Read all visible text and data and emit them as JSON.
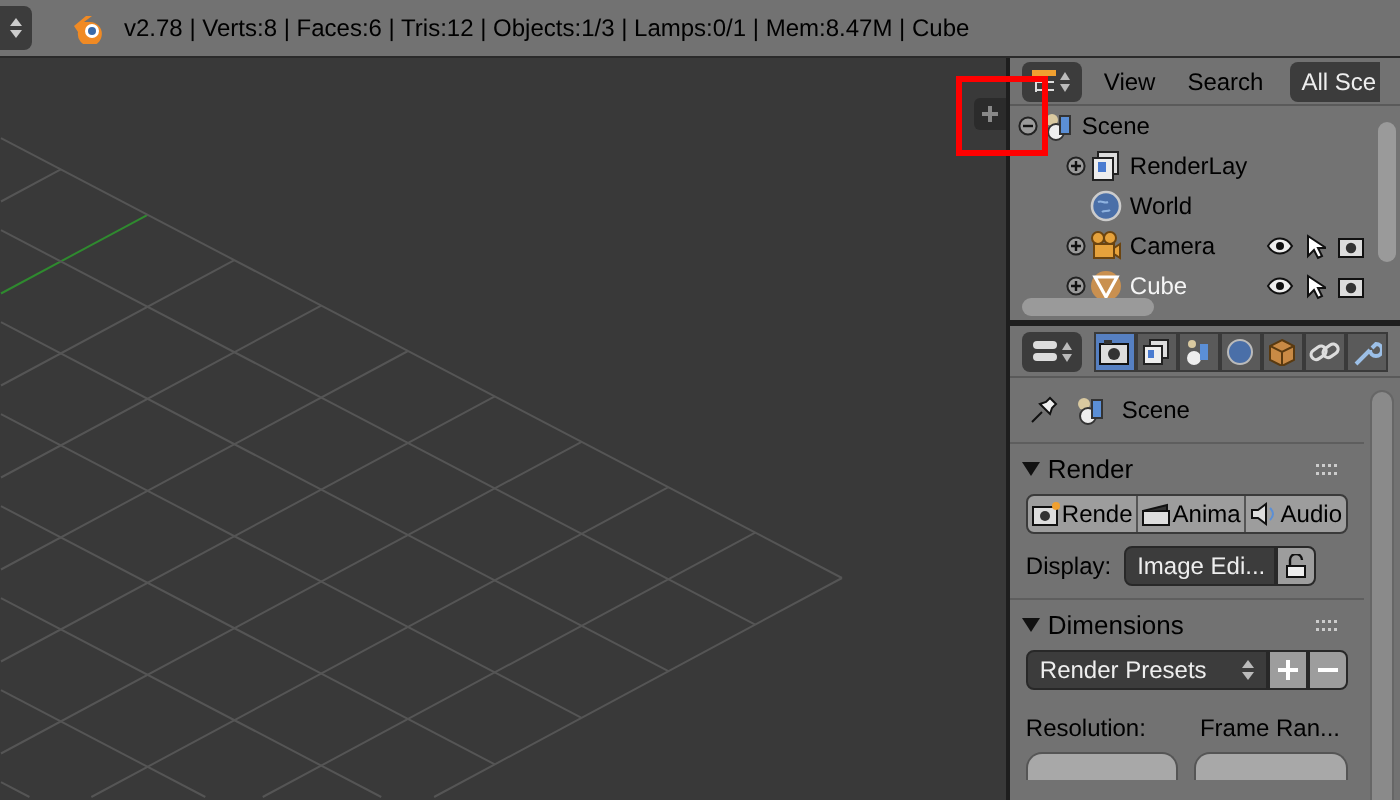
{
  "info_bar": {
    "stats": "v2.78 | Verts:8 | Faces:6 | Tris:12 | Objects:1/3 | Lamps:0/1 | Mem:8.47M | Cube"
  },
  "outliner": {
    "menus": [
      "View",
      "Search"
    ],
    "scene_selector": "All Sce",
    "items": [
      {
        "name": "Scene",
        "kind": "scene",
        "expanded": true,
        "children": [
          {
            "name": "RenderLay",
            "kind": "render_layers",
            "expanded": false,
            "selected": false
          },
          {
            "name": "World",
            "kind": "world",
            "selected": false
          },
          {
            "name": "Camera",
            "kind": "camera",
            "expanded": false,
            "selected": false
          },
          {
            "name": "Cube",
            "kind": "mesh",
            "expanded": false,
            "selected": true
          }
        ]
      }
    ]
  },
  "properties": {
    "tabs": [
      {
        "kind": "render",
        "selected": true
      },
      {
        "kind": "render_layers",
        "selected": false
      },
      {
        "kind": "scene",
        "selected": false
      },
      {
        "kind": "world",
        "selected": false
      },
      {
        "kind": "object",
        "selected": false
      },
      {
        "kind": "constraints",
        "selected": false
      },
      {
        "kind": "modifiers",
        "selected": false
      }
    ],
    "context": "Scene",
    "panels": [
      {
        "kind": "render",
        "title": "Render",
        "expanded": true,
        "buttons": [
          "Rende",
          "Anima",
          "Audio"
        ],
        "display_label": "Display:",
        "display_value": "Image Edi..."
      },
      {
        "kind": "dimensions",
        "title": "Dimensions",
        "expanded": true,
        "preset": "Render Presets",
        "labels": [
          "Resolution:",
          "Frame Ran..."
        ]
      }
    ]
  }
}
